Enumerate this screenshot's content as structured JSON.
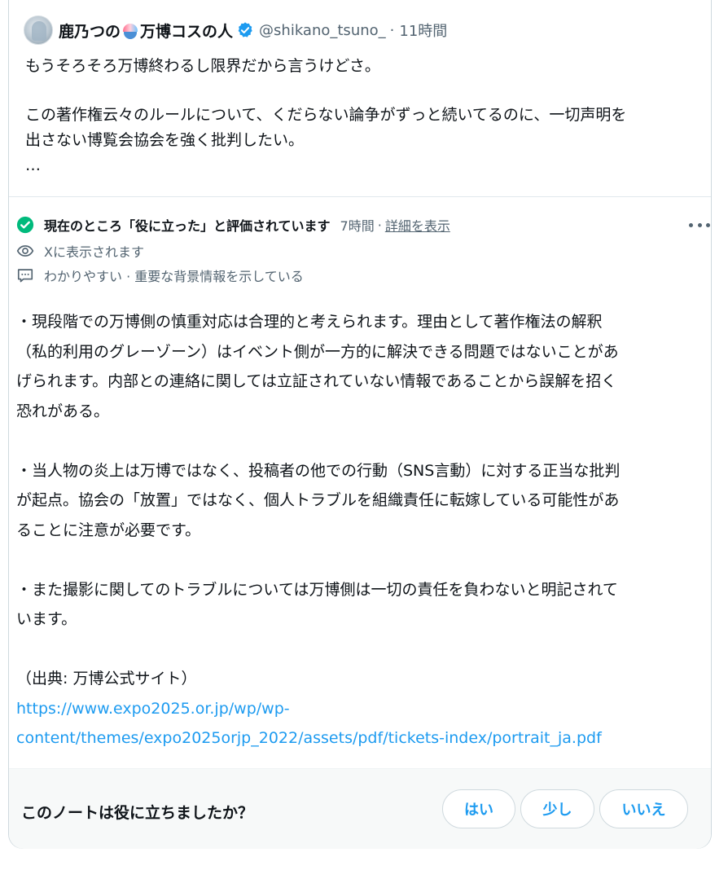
{
  "post": {
    "display_name_prefix": "鹿乃つの",
    "display_name_suffix": "万博コスの人",
    "handle": "@shikano_tsuno_",
    "separator": "·",
    "time": "11時間",
    "text_lines": [
      "もうそろそろ万博終わるし限界だから言うけどさ。",
      "この著作権云々のルールについて、くだらない論争がずっと続いてるのに、一切声明を",
      "出さない博覧会協会を強く批判したい。",
      "…"
    ]
  },
  "note": {
    "status_label": "現在のところ「役に立った」と評価されています",
    "status_time": "7時間",
    "status_separator": "·",
    "details_link": "詳細を表示",
    "visibility_text": "Xに表示されます",
    "reasons_text": "わかりやすい · 重要な背景情報を示している",
    "paragraph1": [
      "・現段階での万博側の慎重対応は合理的と考えられます。理由として著作権法の解釈",
      "（私的利用のグレーゾーン）はイベント側が一方的に解決できる問題ではないことがあ",
      "げられます。内部との連絡に関しては立証されていない情報であることから誤解を招く",
      "恐れがある。"
    ],
    "paragraph2": [
      "・当人物の炎上は万博ではなく、投稿者の他での行動（SNS言動）に対する正当な批判",
      "が起点。協会の「放置」ではなく、個人トラブルを組織責任に転嫁している可能性があ",
      "ることに注意が必要です。"
    ],
    "paragraph3": [
      "・また撮影に関してのトラブルについては万博側は一切の責任を負わないと明記されて",
      "います。"
    ],
    "source_label": "（出典: 万博公式サイト）",
    "source_link_line1": "https://www.expo2025.or.jp/wp/wp-",
    "source_link_line2": "content/themes/expo2025orjp_2022/assets/pdf/tickets-index/portrait_ja.pdf"
  },
  "feedback": {
    "question": "このノートは役に立ちましたか？",
    "buttons": [
      "はい",
      "少し",
      "いいえ"
    ]
  },
  "icons": {
    "verified": "verified-badge-icon",
    "status": "check-circle-icon",
    "visibility": "eye-icon",
    "reasons": "comment-icon",
    "more": "more-options-icon",
    "emoji": "shaved-ice-emoji-icon"
  },
  "colors": {
    "accent": "#1d9bf0",
    "helpful_green": "#00ba7c",
    "muted_text": "#536471",
    "text": "#0f1419",
    "border": "#cfd9de",
    "footer_bg": "#f7f9f9"
  }
}
